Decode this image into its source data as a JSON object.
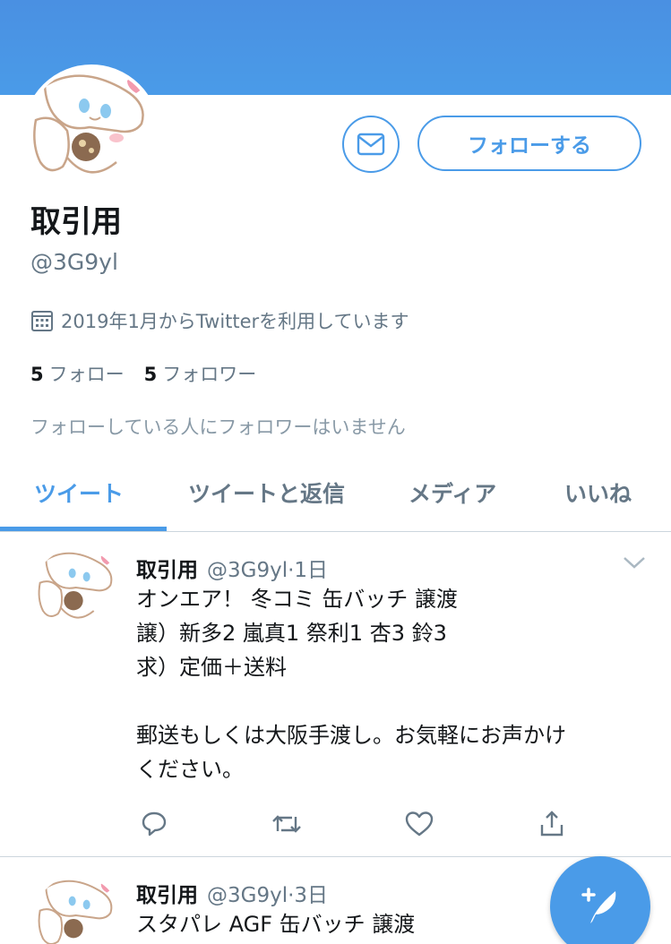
{
  "profile": {
    "name": "取引用",
    "handle": "@3G9yl",
    "joined": "2019年1月からTwitterを利用しています",
    "following_count": "5",
    "following_label": "フォロー",
    "followers_count": "5",
    "followers_label": "フォロワー",
    "no_mutuals": "フォローしている人にフォロワーはいません",
    "follow_button": "フォローする"
  },
  "tabs": [
    {
      "label": "ツイート",
      "active": true
    },
    {
      "label": "ツイートと返信",
      "active": false
    },
    {
      "label": "メディア",
      "active": false
    },
    {
      "label": "いいね",
      "active": false
    }
  ],
  "tweets": [
    {
      "name": "取引用",
      "handle": "@3G9yl",
      "time": "·1日",
      "text": "オンエア！ 冬コミ 缶バッチ 譲渡\n譲）新多2 嵐真1 祭利1 杏3 鈴3\n求）定価＋送料\n\n郵送もしくは大阪手渡し。お気軽にお声かけ\nください。"
    },
    {
      "name": "取引用",
      "handle": "@3G9yl",
      "time": "·3日",
      "text": "スタパレ AGF 缶バッチ 譲渡"
    }
  ],
  "icons": {
    "mail": "mail-icon",
    "calendar": "calendar-icon",
    "reply": "reply-icon",
    "retweet": "retweet-icon",
    "like": "like-icon",
    "share": "share-icon",
    "compose": "compose-icon",
    "chevron": "chevron-down-icon"
  },
  "colors": {
    "accent": "#4a9be8",
    "banner": "#4a90e2"
  }
}
